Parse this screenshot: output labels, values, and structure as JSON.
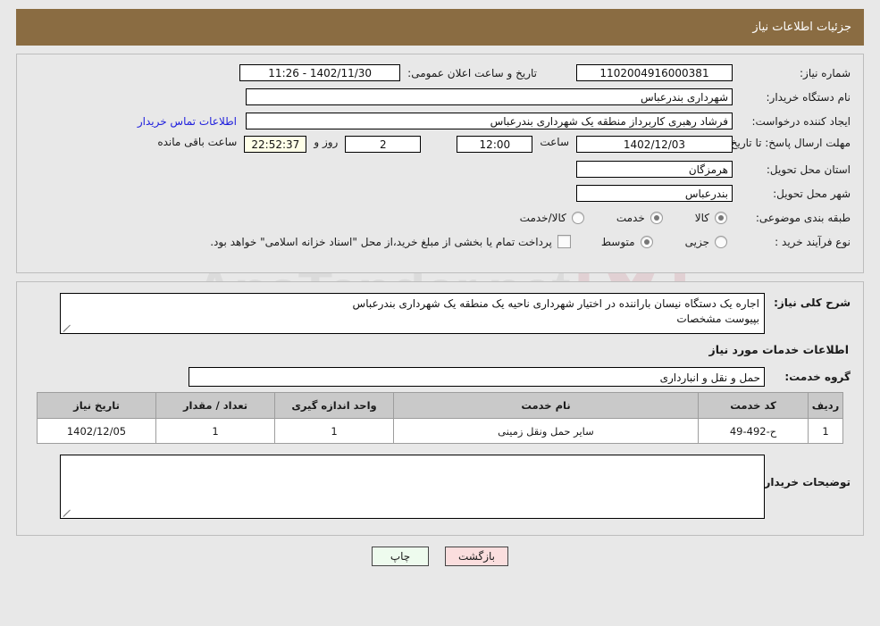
{
  "header": {
    "title": "جزئیات اطلاعات نیاز"
  },
  "watermark": {
    "text": "AnaTender.net"
  },
  "form": {
    "need_number_label": "شماره نیاز:",
    "need_number_value": "1102004916000381",
    "announce_datetime_label": "تاریخ و ساعت اعلان عمومی:",
    "announce_datetime_value": "1402/11/30 - 11:26",
    "buyer_org_label": "نام دستگاه خریدار:",
    "buyer_org_value": "شهرداری بندرعباس",
    "requester_label": "ایجاد کننده درخواست:",
    "requester_value": "فرشاد رهبری کاربرداز منطقه یک شهرداری بندرعباس",
    "contact_link": "اطلاعات تماس خریدار",
    "deadline_label": "مهلت ارسال پاسخ: تا تاریخ:",
    "deadline_date": "1402/12/03",
    "hour_label": "ساعت",
    "hour_value": "12:00",
    "days_value": "2",
    "days_label": "روز و",
    "countdown_value": "22:52:37",
    "countdown_label": "ساعت باقی مانده",
    "province_label": "استان محل تحویل:",
    "province_value": "هرمزگان",
    "city_label": "شهر محل تحویل:",
    "city_value": "بندرعباس",
    "category_label": "طبقه بندی موضوعی:",
    "category_options": [
      {
        "label": "کالا",
        "selected": false
      },
      {
        "label": "خدمت",
        "selected": true
      },
      {
        "label": "کالا/خدمت",
        "selected": false
      }
    ],
    "purchase_type_label": "نوع فرآیند خرید :",
    "purchase_type_options": [
      {
        "label": "جزیی",
        "selected": false
      },
      {
        "label": "متوسط",
        "selected": true
      }
    ],
    "treasury_checkbox_checked": false,
    "treasury_text": "پرداخت تمام یا بخشی از مبلغ خرید،از محل \"اسناد خزانه اسلامی\" خواهد بود."
  },
  "details": {
    "need_desc_label": "شرح کلی نیاز:",
    "need_desc_value": "اجاره یک دستگاه نیسان باراننده در اختیار شهرداری ناحیه یک منطقه یک شهرداری بندرعباس\nبپیوست مشخصات",
    "services_section_title": "اطلاعات خدمات مورد نیاز",
    "service_group_label": "گروه خدمت:",
    "service_group_value": "حمل و نقل و انبارداری"
  },
  "table": {
    "columns": [
      "ردیف",
      "کد خدمت",
      "نام خدمت",
      "واحد اندازه گیری",
      "تعداد / مقدار",
      "تاریخ نیاز"
    ],
    "rows": [
      {
        "row_no": "1",
        "service_code": "ح-492-49",
        "service_name": "سایر حمل ونقل زمینی",
        "unit": "1",
        "quantity": "1",
        "need_date": "1402/12/05"
      }
    ]
  },
  "buyer_notes": {
    "label": "توضیحات خریدار;",
    "value": ""
  },
  "buttons": {
    "print": "چاپ",
    "back": "بازگشت"
  }
}
